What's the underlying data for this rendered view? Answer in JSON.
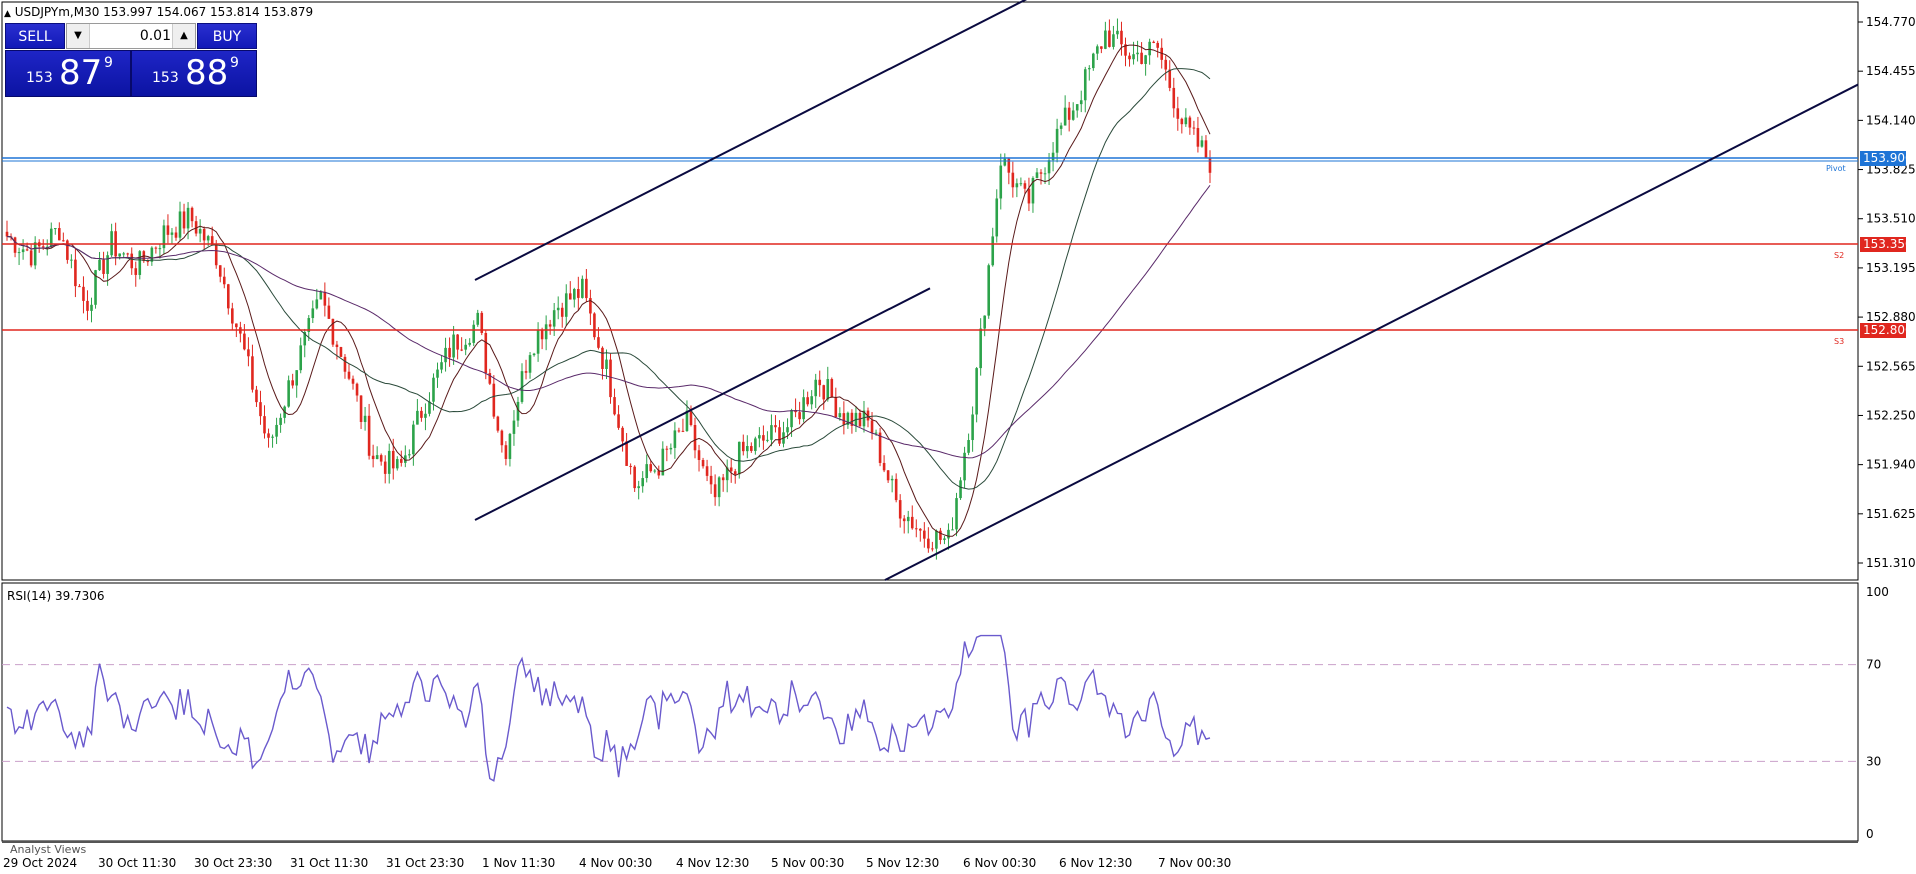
{
  "header": {
    "symbol_line": "USDJPYm,M30  153.997 154.067 153.814 153.879"
  },
  "trade_panel": {
    "sell_label": "SELL",
    "buy_label": "BUY",
    "lot_value": "0.01",
    "sell_price_small": "153",
    "sell_price_big": "87",
    "sell_price_sup": "9",
    "buy_price_small": "153",
    "buy_price_big": "88",
    "buy_price_sup": "9"
  },
  "price_axis": {
    "ticks": [
      "154.770",
      "154.455",
      "154.140",
      "153.825",
      "153.510",
      "153.195",
      "152.880",
      "152.565",
      "152.250",
      "151.940",
      "151.625",
      "151.310"
    ],
    "tags": [
      {
        "label": "153.900",
        "color": "#1e74d6"
      },
      {
        "label": "153.350",
        "color": "#e0271f"
      },
      {
        "label": "152.800",
        "color": "#e0271f"
      }
    ]
  },
  "levels": {
    "pivot_label": "Pivot",
    "s2_label": "S2",
    "s3_label": "S3"
  },
  "rsi": {
    "title": "RSI(14) 39.7306",
    "ticks": [
      "100",
      "70",
      "30",
      "0"
    ]
  },
  "footer": {
    "analyst_tab": "Analyst Views",
    "dates": [
      "29 Oct 2024",
      "30 Oct 11:30",
      "30 Oct 23:30",
      "31 Oct 11:30",
      "31 Oct 23:30",
      "1 Nov 11:30",
      "4 Nov 00:30",
      "4 Nov 12:30",
      "5 Nov 00:30",
      "5 Nov 12:30",
      "6 Nov 00:30",
      "6 Nov 12:30",
      "7 Nov 00:30"
    ]
  },
  "colors": {
    "bull_candle": "#2ca34a",
    "bear_candle": "#e0271f",
    "channel": "#0a0a40",
    "ma_fast": "#5a1a1a",
    "ma_mid": "#2a4a3a",
    "ma_slow": "#5a2a6a",
    "rsi_line": "#6a5acd",
    "pivot": "#1e74d6",
    "support": "#e0271f"
  },
  "chart_data": {
    "type": "candlestick",
    "symbol": "USDJPYm",
    "timeframe": "M30",
    "ylim": [
      151.2,
      154.85
    ],
    "close_path": [
      [
        "29 Oct 2024",
        153.4
      ],
      [
        "29 Oct 2024",
        153.28
      ],
      [
        "29 Oct 2024",
        153.45
      ],
      [
        "29 Oct 2024",
        152.95
      ],
      [
        "30 Oct 11:30",
        153.35
      ],
      [
        "30 Oct 11:30",
        153.2
      ],
      [
        "30 Oct 11:30",
        153.42
      ],
      [
        "30 Oct 11:30",
        153.52
      ],
      [
        "30 Oct 23:30",
        153.28
      ],
      [
        "30 Oct 23:30",
        152.7
      ],
      [
        "30 Oct 23:30",
        152.05
      ],
      [
        "30 Oct 23:30",
        152.55
      ],
      [
        "31 Oct 11:30",
        153.0
      ],
      [
        "31 Oct 11:30",
        152.55
      ],
      [
        "31 Oct 11:30",
        152.0
      ],
      [
        "31 Oct 11:30",
        151.9
      ],
      [
        "31 Oct 23:30",
        152.35
      ],
      [
        "31 Oct 23:30",
        152.7
      ],
      [
        "31 Oct 23:30",
        152.85
      ],
      [
        "31 Oct 23:30",
        152.0
      ],
      [
        "1 Nov 11:30",
        152.7
      ],
      [
        "1 Nov 11:30",
        152.95
      ],
      [
        "1 Nov 11:30",
        153.05
      ],
      [
        "4 Nov 00:30",
        152.5
      ],
      [
        "4 Nov 00:30",
        151.8
      ],
      [
        "4 Nov 00:30",
        151.95
      ],
      [
        "4 Nov 00:30",
        152.2
      ],
      [
        "4 Nov 12:30",
        151.7
      ],
      [
        "4 Nov 12:30",
        152.0
      ],
      [
        "4 Nov 12:30",
        152.1
      ],
      [
        "5 Nov 00:30",
        152.2
      ],
      [
        "5 Nov 00:30",
        152.5
      ],
      [
        "5 Nov 00:30",
        152.25
      ],
      [
        "5 Nov 00:30",
        152.2
      ],
      [
        "5 Nov 12:30",
        151.7
      ],
      [
        "5 Nov 12:30",
        151.5
      ],
      [
        "5 Nov 12:30",
        151.45
      ],
      [
        "6 Nov 00:30",
        152.4
      ],
      [
        "6 Nov 00:30",
        153.9
      ],
      [
        "6 Nov 00:30",
        153.6
      ],
      [
        "6 Nov 00:30",
        154.0
      ],
      [
        "6 Nov 12:30",
        154.3
      ],
      [
        "6 Nov 12:30",
        154.7
      ],
      [
        "6 Nov 12:30",
        154.55
      ],
      [
        "7 Nov 00:30",
        154.6
      ],
      [
        "7 Nov 00:30",
        154.1
      ],
      [
        "7 Nov 00:30",
        153.88
      ]
    ],
    "horizontal_levels": [
      153.9,
      153.35,
      152.8
    ],
    "rsi_ylim": [
      0,
      100
    ],
    "rsi_levels": [
      70,
      30
    ],
    "rsi_last": 39.7306
  }
}
